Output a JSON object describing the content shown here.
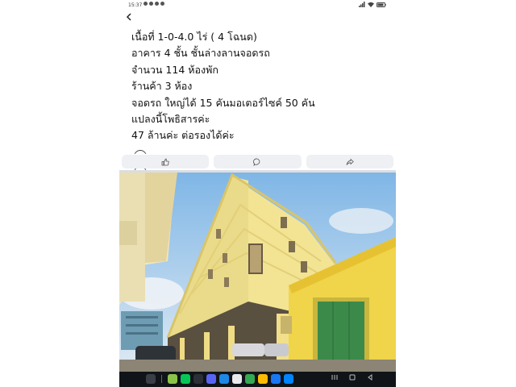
{
  "status_bar": {
    "time": "15:37",
    "battery_icon": "battery-icon",
    "wifi_icon": "wifi-icon",
    "signal_icon": "signal-icon"
  },
  "header": {
    "back_icon": "chevron-left-icon"
  },
  "post": {
    "lines": [
      "เนื้อที่  1-0-4.0 ไร่  ( 4 โฉนด)",
      "อาคาร 4 ชั้น   ชั้นล่างลานจอดรถ",
      "จำนวน 114 ห้องพัก",
      "ร้านค้า 3 ห้อง",
      "จอดรถ ใหญ่ได้ 15 คันมอเตอร์ไซค์ 50 คัน",
      "แปลงนี้โพธิสารค่ะ",
      "47 ล้านค่ะ ต่อรองได้ค่ะ"
    ]
  },
  "actions": {
    "like_icon": "thumbs-up-icon",
    "comment_icon": "comment-icon",
    "share_icon": "share-icon"
  },
  "photo": {
    "description_icon": "building-photo"
  },
  "colors": {
    "building": "#f1df8c",
    "sky": "#8fc3e8",
    "nav_bg": "#101418",
    "action_bg": "#eef0f3"
  },
  "navbar": {
    "apps": [
      "app-grid",
      "line",
      "line-green",
      "dark-app",
      "discord",
      "files",
      "google-maps",
      "messages",
      "chrome",
      "facebook",
      "messenger"
    ]
  }
}
